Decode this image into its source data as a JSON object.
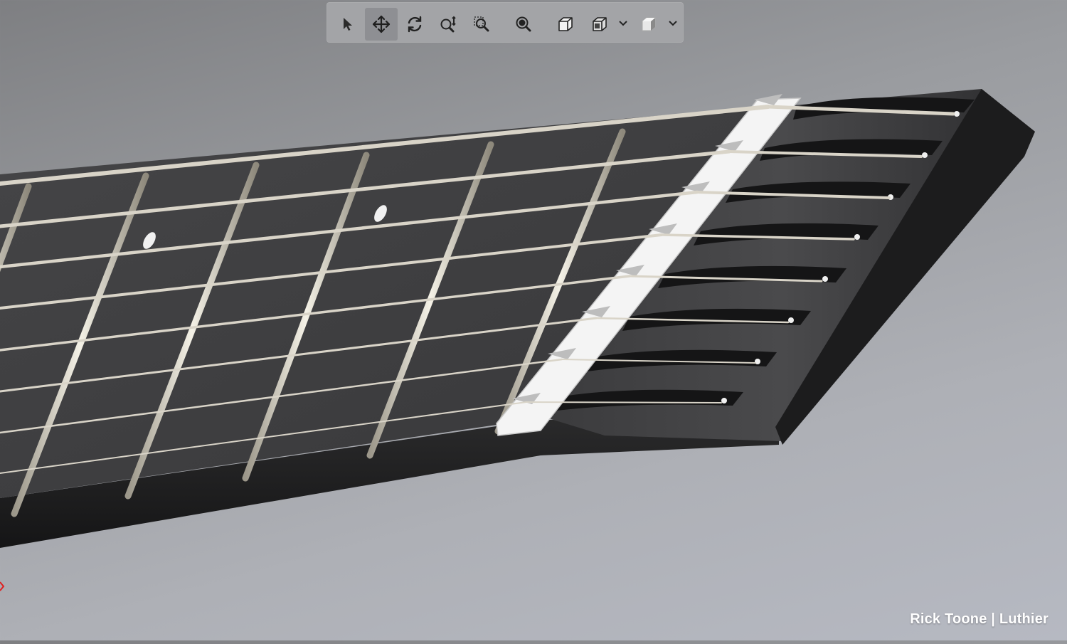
{
  "toolbar": {
    "tools": [
      {
        "name": "select-tool",
        "icon": "pointer-arrow-icon",
        "active": false
      },
      {
        "name": "pan-tool",
        "icon": "move-arrows-icon",
        "active": true
      },
      {
        "name": "rotate-tool",
        "icon": "rotate-icon",
        "active": false
      },
      {
        "name": "zoom-in-out-tool",
        "icon": "zoom-in-out-icon",
        "active": false
      },
      {
        "name": "zoom-to-area-tool",
        "icon": "zoom-area-icon",
        "active": false
      },
      {
        "name": "zoom-to-fit-tool",
        "icon": "zoom-fit-icon",
        "active": false
      },
      {
        "name": "view-orientation-tool",
        "icon": "cube-view-icon",
        "active": false
      },
      {
        "name": "display-style-tool",
        "icon": "display-style-icon",
        "active": false
      },
      {
        "name": "shaded-view-tool",
        "icon": "shaded-cube-icon",
        "active": false
      }
    ]
  },
  "watermark": {
    "text": "Rick Toone | Luthier"
  },
  "colors": {
    "background_top": "#7e7f82",
    "background_bottom": "#b6b9c2",
    "fretboard": "#3b3b3d",
    "headstock": "#2e2e30",
    "string": "#d9d4c8",
    "nut": "#f2f2f2",
    "axis_triad_x": "#e02020"
  }
}
